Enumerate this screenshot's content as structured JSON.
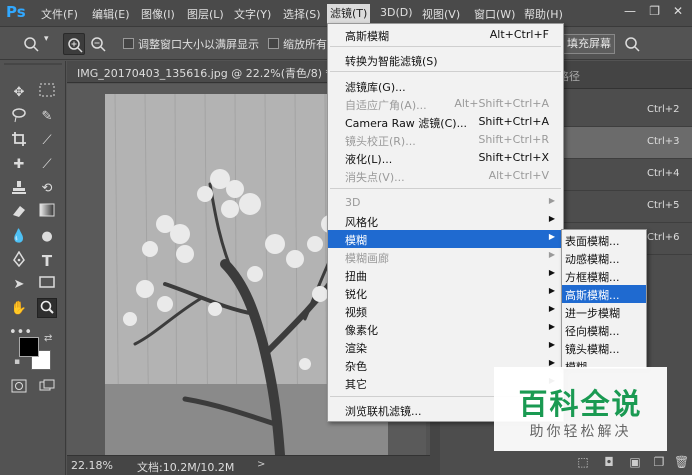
{
  "app": {
    "logo": "Ps"
  },
  "menubar": {
    "items": [
      "文件(F)",
      "编辑(E)",
      "图像(I)",
      "图层(L)",
      "文字(Y)",
      "选择(S)",
      "滤镜(T)",
      "3D(D)",
      "视图(V)",
      "窗口(W)",
      "帮助(H)"
    ],
    "active": "滤镜(T)"
  },
  "window_controls": {
    "minimize": "—",
    "restore": "❐",
    "close": "✕"
  },
  "options_bar": {
    "resize_window_label": "调整窗口大小以满屏显示",
    "zoom_all_label": "缩放所有",
    "fill_screen_label": "填充屏幕"
  },
  "document": {
    "tab_title": "IMG_20170403_135616.jpg @ 22.2%(青色/8) *",
    "close_icon": "×",
    "zoom": "22.18%",
    "doc_size": "文档:10.2M/10.2M"
  },
  "right_panel": {
    "tab_partial": "路径",
    "channels": [
      {
        "shortcut": "Ctrl+2",
        "selected": false
      },
      {
        "shortcut": "Ctrl+3",
        "selected": true
      },
      {
        "shortcut": "Ctrl+4",
        "selected": false
      },
      {
        "shortcut": "Ctrl+5",
        "selected": false
      },
      {
        "shortcut": "Ctrl+6",
        "selected": false
      }
    ]
  },
  "filter_menu": {
    "items": [
      {
        "label": "高斯模糊",
        "shortcut": "Alt+Ctrl+F",
        "disabled": false
      },
      {
        "label": "转换为智能滤镜(S)",
        "shortcut": "",
        "disabled": false
      },
      {
        "label": "滤镜库(G)...",
        "shortcut": "",
        "disabled": false
      },
      {
        "label": "自适应广角(A)...",
        "shortcut": "Alt+Shift+Ctrl+A",
        "disabled": true
      },
      {
        "label": "Camera Raw 滤镜(C)...",
        "shortcut": "Shift+Ctrl+A",
        "disabled": false
      },
      {
        "label": "镜头校正(R)...",
        "shortcut": "Shift+Ctrl+R",
        "disabled": true
      },
      {
        "label": "液化(L)...",
        "shortcut": "Shift+Ctrl+X",
        "disabled": false
      },
      {
        "label": "消失点(V)...",
        "shortcut": "Alt+Ctrl+V",
        "disabled": true
      },
      {
        "label": "3D",
        "submenu": true,
        "disabled": true
      },
      {
        "label": "风格化",
        "submenu": true,
        "disabled": false
      },
      {
        "label": "模糊",
        "submenu": true,
        "disabled": false,
        "highlighted": true
      },
      {
        "label": "模糊画廊",
        "submenu": true,
        "disabled": true
      },
      {
        "label": "扭曲",
        "submenu": true,
        "disabled": false
      },
      {
        "label": "锐化",
        "submenu": true,
        "disabled": false
      },
      {
        "label": "视频",
        "submenu": true,
        "disabled": false
      },
      {
        "label": "像素化",
        "submenu": true,
        "disabled": false
      },
      {
        "label": "渲染",
        "submenu": true,
        "disabled": false
      },
      {
        "label": "杂色",
        "submenu": true,
        "disabled": false
      },
      {
        "label": "其它",
        "submenu": true,
        "disabled": false
      },
      {
        "label": "浏览联机滤镜...",
        "shortcut": "",
        "disabled": false
      }
    ]
  },
  "blur_submenu": {
    "items": [
      {
        "label": "表面模糊...",
        "highlighted": false
      },
      {
        "label": "动感模糊...",
        "highlighted": false
      },
      {
        "label": "方框模糊...",
        "highlighted": false
      },
      {
        "label": "高斯模糊...",
        "highlighted": true
      },
      {
        "label": "进一步模糊",
        "highlighted": false
      },
      {
        "label": "径向模糊...",
        "highlighted": false
      },
      {
        "label": "镜头模糊...",
        "highlighted": false
      },
      {
        "label": "模糊",
        "highlighted": false
      }
    ]
  },
  "watermark": {
    "title": "百科全说",
    "subtitle": "助你轻松解决"
  },
  "colors": {
    "menu_highlight": "#1f6ad0",
    "ps_blue": "#31a8ff",
    "watermark_green": "#1a9a52"
  }
}
